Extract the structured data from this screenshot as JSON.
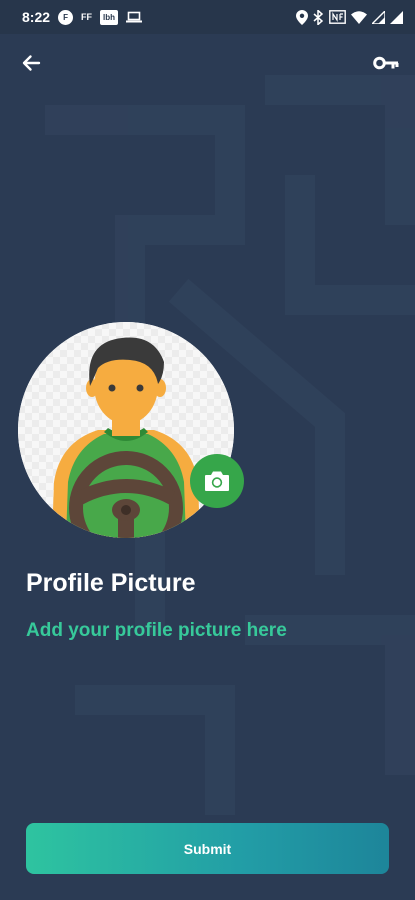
{
  "status_bar": {
    "time": "8:22",
    "chip_f": "F",
    "chip_ff": "FF",
    "chip_lbh": "lbh",
    "icons": [
      "notification-f-icon",
      "ff-icon",
      "lbh-icon",
      "laptop-icon",
      "location-icon",
      "bluetooth-icon",
      "nfc-icon",
      "wifi-icon",
      "signal-icon",
      "signal-icon"
    ]
  },
  "app_bar": {
    "icons": [
      "back-arrow-icon",
      "key-icon"
    ]
  },
  "profile": {
    "title": "Profile Picture",
    "subtitle": "Add your profile picture here",
    "camera_icon": "camera-icon"
  },
  "actions": {
    "submit_label": "Submit"
  },
  "colors": {
    "background": "#2b3b54",
    "accent_green": "#36a64a",
    "subtitle_teal": "#37c99a",
    "button_gradient_start": "#2ec4a0",
    "button_gradient_end": "#1d859a"
  }
}
